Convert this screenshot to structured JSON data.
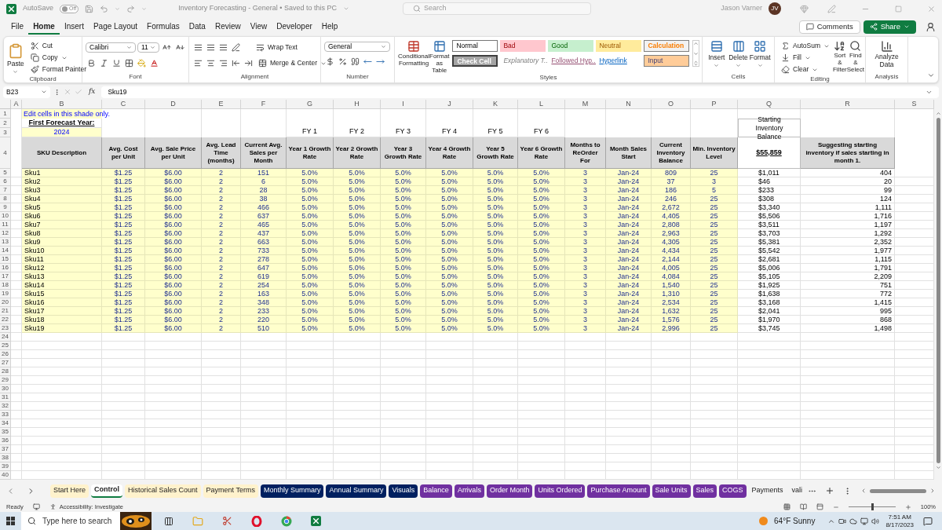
{
  "title_bar": {
    "autosave_label": "AutoSave",
    "autosave": {
      "label": "Off",
      "on": false
    },
    "title": "Inventory Forecasting - General • Saved to this PC",
    "search": {
      "placeholder": "Search"
    },
    "user": "Jason Varner",
    "initials": "JV"
  },
  "menu": [
    {
      "label": "File",
      "selected": false
    },
    {
      "label": "Home",
      "selected": true
    },
    {
      "label": "Insert",
      "selected": false
    },
    {
      "label": "Page Layout",
      "selected": false
    },
    {
      "label": "Formulas",
      "selected": false
    },
    {
      "label": "Data",
      "selected": false
    },
    {
      "label": "Review",
      "selected": false
    },
    {
      "label": "View",
      "selected": false
    },
    {
      "label": "Developer",
      "selected": false
    },
    {
      "label": "Help",
      "selected": false
    }
  ],
  "menu_buttons": {
    "comments": "Comments",
    "share": "Share"
  },
  "ribbon": {
    "clipboard": {
      "paste": "Paste",
      "cut": "Cut",
      "copy": "Copy",
      "format_painter": "Format Painter",
      "label": "Clipboard"
    },
    "font": {
      "name": "Calibri",
      "size": "11",
      "label": "Font"
    },
    "alignment": {
      "wrap": "Wrap Text",
      "merge": "Merge & Center",
      "label": "Alignment"
    },
    "number": {
      "format": "General",
      "label": "Number"
    },
    "styles": {
      "conditional": "Conditional Formatting",
      "format_table": "Format as Table",
      "label": "Styles",
      "gallery": [
        {
          "label": "Normal",
          "kind": "normal"
        },
        {
          "label": "Bad",
          "kind": "bad"
        },
        {
          "label": "Good",
          "kind": "good"
        },
        {
          "label": "Neutral",
          "kind": "neutral"
        },
        {
          "label": "Calculation",
          "kind": "calculation"
        },
        {
          "label": "Check Cell",
          "kind": "check"
        },
        {
          "label": "Explanatory T...",
          "kind": "explanatory"
        },
        {
          "label": "Followed Hyp...",
          "kind": "followed"
        },
        {
          "label": "Hyperlink",
          "kind": "hyperlink"
        },
        {
          "label": "Input",
          "kind": "input"
        }
      ]
    },
    "cells": {
      "items": [
        "Insert",
        "Delete",
        "Format"
      ],
      "label": "Cells"
    },
    "editing": {
      "autosum": "AutoSum",
      "fill": "Fill",
      "clear": "Clear",
      "sort": "Sort & Filter",
      "find": "Find & Select",
      "label": "Editing"
    },
    "analysis": {
      "analyze": "Analyze Data",
      "label": "Analysis"
    }
  },
  "formula_bar": {
    "name_box": "B23",
    "fx": "fx",
    "formula": "Sku19"
  },
  "sheet": {
    "columns": [
      "A",
      "B",
      "C",
      "D",
      "E",
      "F",
      "G",
      "H",
      "I",
      "J",
      "K",
      "L",
      "M",
      "N",
      "O",
      "P",
      "Q",
      "R",
      "S"
    ],
    "row_numbers": [
      "1",
      "2",
      "3",
      "4",
      "5",
      "6",
      "7",
      "8",
      "9",
      "10",
      "11",
      "12",
      "13",
      "14",
      "15",
      "16",
      "17",
      "18",
      "19",
      "20",
      "21",
      "22",
      "23",
      "24",
      "25",
      "26",
      "27",
      "28",
      "29",
      "30",
      "31",
      "32",
      "33",
      "34",
      "35",
      "36",
      "37",
      "38",
      "39",
      "40"
    ],
    "note": "Edit cells in this shade only.",
    "first_year_label": "First Forecast Year:",
    "first_year": "2024",
    "fy_labels": [
      "FY 1",
      "FY 2",
      "FY 3",
      "FY 4",
      "FY 5",
      "FY 6"
    ],
    "starting_balance_label": "Starting Inventory Balance",
    "starting_balance": "$55,859",
    "headers": [
      "SKU Description",
      "Avg. Cost per Unit",
      "Avg. Sale Price per Unit",
      "Avg. Lead Time (months)",
      "Current Avg. Sales per Month",
      "Year 1 Growth Rate",
      "Year 2 Growth Rate",
      "Year 3 Growth Rate",
      "Year 4 Growth Rate",
      "Year 5 Growth Rate",
      "Year 6 Growth Rate",
      "Months to ReOrder For",
      "Month Sales Start",
      "Current Inventory Balance",
      "Min. Inventory Level"
    ],
    "suggest_header": "Suggesting starting inventory if sales starting in month 1.",
    "rows": [
      [
        "",
        "Sku1",
        "$1.25",
        "$6.00",
        "2",
        "151",
        "5.0%",
        "5.0%",
        "5.0%",
        "5.0%",
        "5.0%",
        "5.0%",
        "3",
        "Jan-24",
        "809",
        "25",
        "$1,011",
        "404"
      ],
      [
        "",
        "Sku2",
        "$1.25",
        "$6.00",
        "2",
        "6",
        "5.0%",
        "5.0%",
        "5.0%",
        "5.0%",
        "5.0%",
        "5.0%",
        "3",
        "Jan-24",
        "37",
        "3",
        "$46",
        "20"
      ],
      [
        "",
        "Sku3",
        "$1.25",
        "$6.00",
        "2",
        "28",
        "5.0%",
        "5.0%",
        "5.0%",
        "5.0%",
        "5.0%",
        "5.0%",
        "3",
        "Jan-24",
        "186",
        "5",
        "$233",
        "99"
      ],
      [
        "",
        "Sku4",
        "$1.25",
        "$6.00",
        "2",
        "38",
        "5.0%",
        "5.0%",
        "5.0%",
        "5.0%",
        "5.0%",
        "5.0%",
        "3",
        "Jan-24",
        "246",
        "25",
        "$308",
        "124"
      ],
      [
        "",
        "Sku5",
        "$1.25",
        "$6.00",
        "2",
        "466",
        "5.0%",
        "5.0%",
        "5.0%",
        "5.0%",
        "5.0%",
        "5.0%",
        "3",
        "Jan-24",
        "2,672",
        "25",
        "$3,340",
        "1,111"
      ],
      [
        "",
        "Sku6",
        "$1.25",
        "$6.00",
        "2",
        "637",
        "5.0%",
        "5.0%",
        "5.0%",
        "5.0%",
        "5.0%",
        "5.0%",
        "3",
        "Jan-24",
        "4,405",
        "25",
        "$5,506",
        "1,716"
      ],
      [
        "",
        "Sku7",
        "$1.25",
        "$6.00",
        "2",
        "465",
        "5.0%",
        "5.0%",
        "5.0%",
        "5.0%",
        "5.0%",
        "5.0%",
        "3",
        "Jan-24",
        "2,808",
        "25",
        "$3,511",
        "1,197"
      ],
      [
        "",
        "Sku8",
        "$1.25",
        "$6.00",
        "2",
        "437",
        "5.0%",
        "5.0%",
        "5.0%",
        "5.0%",
        "5.0%",
        "5.0%",
        "3",
        "Jan-24",
        "2,963",
        "25",
        "$3,703",
        "1,292"
      ],
      [
        "",
        "Sku9",
        "$1.25",
        "$6.00",
        "2",
        "663",
        "5.0%",
        "5.0%",
        "5.0%",
        "5.0%",
        "5.0%",
        "5.0%",
        "3",
        "Jan-24",
        "4,305",
        "25",
        "$5,381",
        "2,352"
      ],
      [
        "",
        "Sku10",
        "$1.25",
        "$6.00",
        "2",
        "733",
        "5.0%",
        "5.0%",
        "5.0%",
        "5.0%",
        "5.0%",
        "5.0%",
        "3",
        "Jan-24",
        "4,434",
        "25",
        "$5,542",
        "1,977"
      ],
      [
        "",
        "Sku11",
        "$1.25",
        "$6.00",
        "2",
        "278",
        "5.0%",
        "5.0%",
        "5.0%",
        "5.0%",
        "5.0%",
        "5.0%",
        "3",
        "Jan-24",
        "2,144",
        "25",
        "$2,681",
        "1,115"
      ],
      [
        "",
        "Sku12",
        "$1.25",
        "$6.00",
        "2",
        "647",
        "5.0%",
        "5.0%",
        "5.0%",
        "5.0%",
        "5.0%",
        "5.0%",
        "3",
        "Jan-24",
        "4,005",
        "25",
        "$5,006",
        "1,791"
      ],
      [
        "",
        "Sku13",
        "$1.25",
        "$6.00",
        "2",
        "619",
        "5.0%",
        "5.0%",
        "5.0%",
        "5.0%",
        "5.0%",
        "5.0%",
        "3",
        "Jan-24",
        "4,084",
        "25",
        "$5,105",
        "2,209"
      ],
      [
        "",
        "Sku14",
        "$1.25",
        "$6.00",
        "2",
        "254",
        "5.0%",
        "5.0%",
        "5.0%",
        "5.0%",
        "5.0%",
        "5.0%",
        "3",
        "Jan-24",
        "1,540",
        "25",
        "$1,925",
        "751"
      ],
      [
        "",
        "Sku15",
        "$1.25",
        "$6.00",
        "2",
        "163",
        "5.0%",
        "5.0%",
        "5.0%",
        "5.0%",
        "5.0%",
        "5.0%",
        "3",
        "Jan-24",
        "1,310",
        "25",
        "$1,638",
        "772"
      ],
      [
        "",
        "Sku16",
        "$1.25",
        "$6.00",
        "2",
        "348",
        "5.0%",
        "5.0%",
        "5.0%",
        "5.0%",
        "5.0%",
        "5.0%",
        "3",
        "Jan-24",
        "2,534",
        "25",
        "$3,168",
        "1,415"
      ],
      [
        "",
        "Sku17",
        "$1.25",
        "$6.00",
        "2",
        "233",
        "5.0%",
        "5.0%",
        "5.0%",
        "5.0%",
        "5.0%",
        "5.0%",
        "3",
        "Jan-24",
        "1,632",
        "25",
        "$2,041",
        "995"
      ],
      [
        "",
        "Sku18",
        "$1.25",
        "$6.00",
        "2",
        "220",
        "5.0%",
        "5.0%",
        "5.0%",
        "5.0%",
        "5.0%",
        "5.0%",
        "3",
        "Jan-24",
        "1,576",
        "25",
        "$1,970",
        "868"
      ],
      [
        "",
        "Sku19",
        "$1.25",
        "$6.00",
        "2",
        "510",
        "5.0%",
        "5.0%",
        "5.0%",
        "5.0%",
        "5.0%",
        "5.0%",
        "3",
        "Jan-24",
        "2,996",
        "25",
        "$3,745",
        "1,498"
      ]
    ]
  },
  "sheet_tabs": [
    {
      "label": "Start Here",
      "selected": false,
      "color": "#fff2cc"
    },
    {
      "label": "Control",
      "selected": true
    },
    {
      "label": "Historical Sales Count",
      "selected": false,
      "color": "#fff2cc"
    },
    {
      "label": "Payment Terms",
      "selected": false,
      "color": "#fff2cc"
    },
    {
      "label": "Monthly Summary",
      "selected": false,
      "color": "#002060"
    },
    {
      "label": "Annual Summary",
      "selected": false,
      "color": "#002060"
    },
    {
      "label": "Visuals",
      "selected": false,
      "color": "#002060"
    },
    {
      "label": "Balance",
      "selected": false,
      "color": "#7030a0"
    },
    {
      "label": "Arrivals",
      "selected": false,
      "color": "#7030a0"
    },
    {
      "label": "Order Month",
      "selected": false,
      "color": "#7030a0"
    },
    {
      "label": "Units Ordered",
      "selected": false,
      "color": "#7030a0"
    },
    {
      "label": "Purchase Amount",
      "selected": false,
      "color": "#7030a0"
    },
    {
      "label": "Sale Units",
      "selected": false,
      "color": "#7030a0"
    },
    {
      "label": "Sales",
      "selected": false,
      "color": "#7030a0"
    },
    {
      "label": "COGS",
      "selected": false,
      "color": "#7030a0"
    },
    {
      "label": "Payments",
      "selected": false
    },
    {
      "label": "vali",
      "selected": false
    }
  ],
  "status_bar": {
    "mode": "Ready",
    "accessibility": "Accessibility: Investigate",
    "zoom": {
      "value": "100%",
      "level": 0.5
    }
  },
  "taskbar": {
    "search": {
      "placeholder": "Type here to search"
    },
    "weather": "64°F Sunny",
    "time": "7:51 AM",
    "date": "8/17/2023"
  }
}
